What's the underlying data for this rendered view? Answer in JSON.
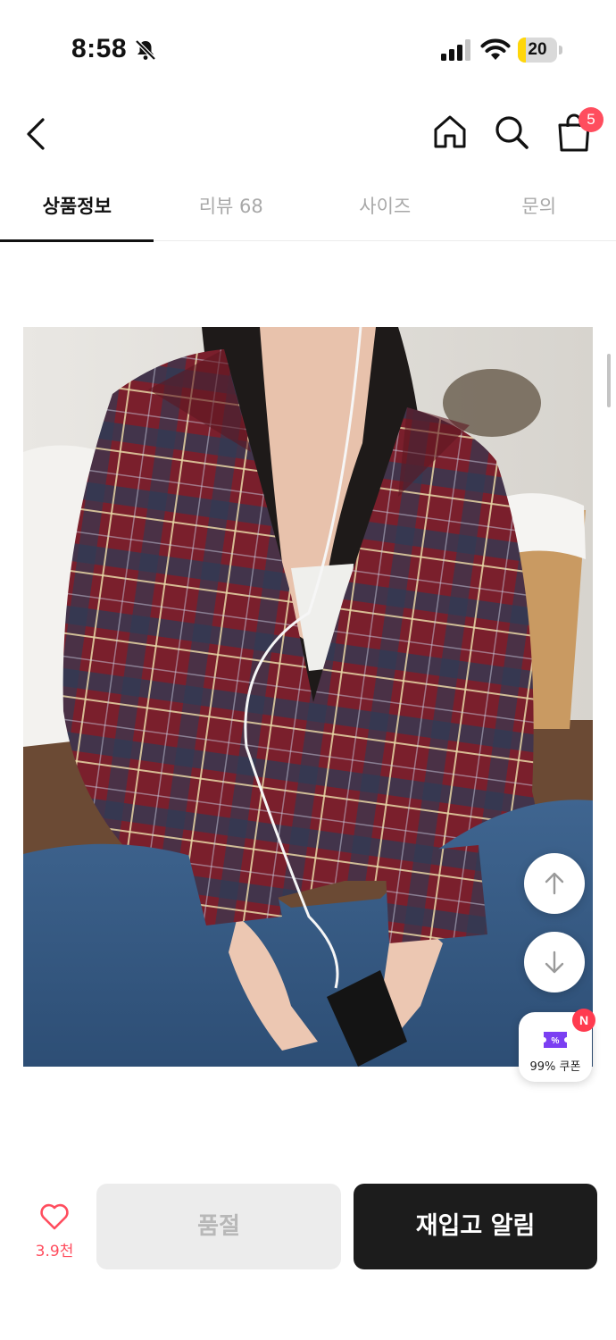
{
  "status_bar": {
    "time": "8:58",
    "battery_level": "20",
    "battery_fraction": 0.2,
    "icons": [
      "bell-off-icon",
      "cellular-signal-icon",
      "wifi-icon",
      "battery-icon"
    ]
  },
  "top_nav": {
    "icons": [
      "back-chevron-icon",
      "home-icon",
      "search-icon",
      "shopping-bag-icon"
    ],
    "cart_count": "5"
  },
  "tabs": [
    {
      "label": "상품정보",
      "active": true
    },
    {
      "label": "리뷰 68",
      "active": false
    },
    {
      "label": "사이즈",
      "active": false
    },
    {
      "label": "문의",
      "active": false
    }
  ],
  "product_image": {
    "icon": "product-photo"
  },
  "floating": {
    "scroll_up_icon": "arrow-up-icon",
    "scroll_down_icon": "arrow-down-icon",
    "coupon_label": "99% 쿠폰",
    "coupon_badge": "N",
    "coupon_icon": "coupon-ticket-icon"
  },
  "bottom_bar": {
    "like_count": "3.9천",
    "soldout_label": "품절",
    "restock_label": "재입고 알림"
  },
  "colors": {
    "accent_red": "#ff4d5e",
    "dark_button": "#1c1c1c",
    "coupon_purple": "#7b3ff2",
    "battery_yellow": "#ffd60a"
  }
}
